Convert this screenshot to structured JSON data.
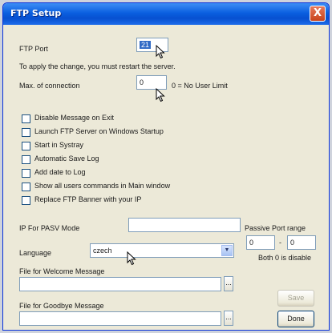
{
  "window": {
    "title": "FTP Setup",
    "close_glyph": "X"
  },
  "ftp_port": {
    "label": "FTP Port",
    "value": "21"
  },
  "restart_note": "To apply the change, you must restart the server.",
  "max_connection": {
    "label": "Max. of connection",
    "value": "0",
    "hint": "0 = No User Limit"
  },
  "options": [
    {
      "label": "Disable Message on Exit",
      "checked": false
    },
    {
      "label": "Launch FTP Server on Windows Startup",
      "checked": false
    },
    {
      "label": "Start in Systray",
      "checked": false
    },
    {
      "label": "Automatic Save Log",
      "checked": false
    },
    {
      "label": "Add date to Log",
      "checked": false
    },
    {
      "label": "Show all users commands in Main window",
      "checked": false
    },
    {
      "label": "Replace FTP Banner with your IP",
      "checked": false
    }
  ],
  "pasv": {
    "ip_label": "IP For PASV Mode",
    "ip_value": "",
    "range_label": "Passive Port range",
    "range_from": "0",
    "range_sep": "-",
    "range_to": "0",
    "range_hint": "Both 0 is disable"
  },
  "language": {
    "label": "Language",
    "selected": "czech",
    "dropdown_glyph": "▼"
  },
  "welcome": {
    "label": "File for Welcome Message",
    "value": "",
    "browse_label": "..."
  },
  "goodbye": {
    "label": "File for Goodbye Message",
    "value": "",
    "browse_label": "..."
  },
  "buttons": {
    "save_label": "Save",
    "done_label": "Done"
  }
}
